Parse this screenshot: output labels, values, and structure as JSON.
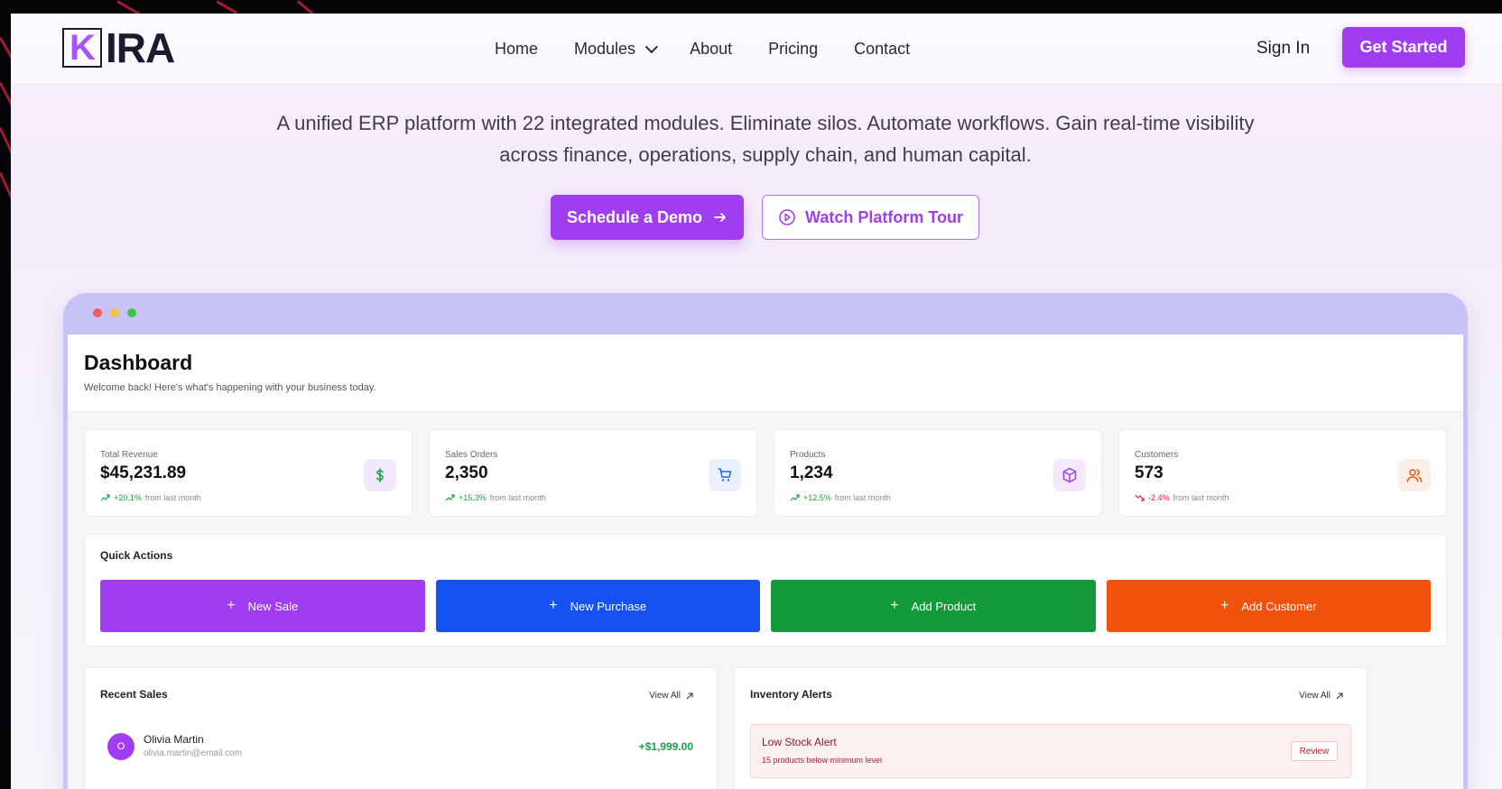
{
  "brand": {
    "logo_first": "K",
    "logo_rest": "IRA"
  },
  "nav": {
    "links": [
      "Home",
      "Modules",
      "About",
      "Pricing",
      "Contact"
    ],
    "sign_in": "Sign In",
    "get_started": "Get Started"
  },
  "hero": {
    "line1": "A unified ERP platform with 22 integrated modules. Eliminate silos. Automate workflows. Gain real-time visibility",
    "line2": "across finance, operations, supply chain, and human capital.",
    "primary_cta": "Schedule a Demo",
    "secondary_cta": "Watch Platform Tour"
  },
  "colors": {
    "accent": "#a13df0",
    "new_sale": "#a13df0",
    "new_purchase": "#1652f0",
    "add_product": "#149a3a",
    "add_customer": "#f0520c",
    "window_chrome": "#c7c3f7"
  },
  "dashboard": {
    "title": "Dashboard",
    "subtitle": "Welcome back! Here's what's happening with your business today.",
    "stats": [
      {
        "label": "Total Revenue",
        "value": "$45,231.89",
        "change": "+20.1%",
        "note": "from last month",
        "icon": "dollar-icon"
      },
      {
        "label": "Sales Orders",
        "value": "2,350",
        "change": "+15.3%",
        "note": "from last month",
        "icon": "cart-icon"
      },
      {
        "label": "Products",
        "value": "1,234",
        "change": "+12.5%",
        "note": "from last month",
        "icon": "package-icon"
      },
      {
        "label": "Customers",
        "value": "573",
        "change": "-2.4%",
        "note": "from last month",
        "icon": "users-icon"
      }
    ],
    "quick_actions": {
      "title": "Quick Actions",
      "buttons": [
        "New Sale",
        "New Purchase",
        "Add Product",
        "Add Customer"
      ]
    },
    "recent_sales": {
      "title": "Recent Sales",
      "view_all": "View All",
      "rows": [
        {
          "initial": "O",
          "name": "Olivia Martin",
          "email": "olivia.martin@email.com",
          "amount": "+$1,999.00"
        }
      ]
    },
    "inventory_alerts": {
      "title": "Inventory Alerts",
      "view_all": "View All",
      "alert_title": "Low Stock Alert",
      "alert_text": "15 products below minimum level",
      "review": "Review"
    }
  }
}
